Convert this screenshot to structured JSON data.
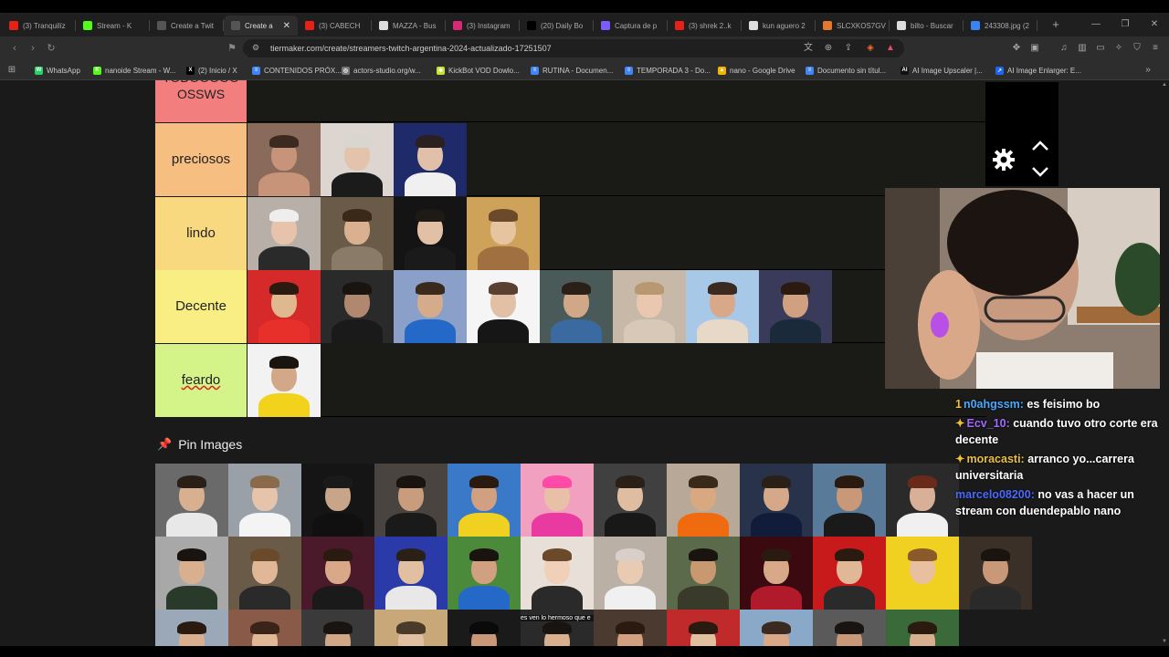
{
  "browser": {
    "tabs": [
      {
        "label": "(3) Tranquilíz",
        "icon": "youtube-icon",
        "color": "#e62117"
      },
      {
        "label": "Stream - K",
        "icon": "kick-icon",
        "color": "#53fc18"
      },
      {
        "label": "Create a Twit",
        "icon": "tiermaker-icon",
        "color": "#555"
      },
      {
        "label": "Create a",
        "icon": "tiermaker-icon",
        "color": "#555",
        "active": true
      },
      {
        "label": "(3) CABECH",
        "icon": "youtube-icon",
        "color": "#e62117"
      },
      {
        "label": "MAZZA - Bus",
        "icon": "google-icon",
        "color": "#ddd"
      },
      {
        "label": "(3) Instagram",
        "icon": "instagram-icon",
        "color": "#d62976"
      },
      {
        "label": "(20) Daily Bo",
        "icon": "x-icon",
        "color": "#000"
      },
      {
        "label": "Captura de p",
        "icon": "pen-icon",
        "color": "#7a5cff"
      },
      {
        "label": "(3) shrek 2..k",
        "icon": "youtube-icon",
        "color": "#e62117"
      },
      {
        "label": "kun aguero 2",
        "icon": "google-icon",
        "color": "#ddd"
      },
      {
        "label": "SLCXKOS7GV",
        "icon": "file-icon",
        "color": "#e8772e"
      },
      {
        "label": "bilto - Buscar",
        "icon": "google-icon",
        "color": "#ddd"
      },
      {
        "label": "243308.jpg (2",
        "icon": "image-icon",
        "color": "#3b82f6"
      }
    ],
    "new_tab": "+",
    "window_controls": {
      "minimize": "—",
      "maximize": "❐",
      "close": "✕"
    },
    "url": "tiermaker.com/create/streamers-twitch-argentina-2024-actualizado-17251507",
    "bookmarks": [
      {
        "label": "WhatsApp",
        "color": "#25d366",
        "glyph": "W"
      },
      {
        "label": "nanoide Stream - W...",
        "color": "#53fc18",
        "glyph": "K"
      },
      {
        "label": "(2) Inicio / X",
        "color": "#000",
        "glyph": "X"
      },
      {
        "label": "CONTENIDOS PRÓX...",
        "color": "#4285f4",
        "glyph": "≡"
      },
      {
        "label": "actors-studio.org/w...",
        "color": "#777",
        "glyph": "◎"
      },
      {
        "label": "KickBot VOD Dowlo...",
        "color": "#c9e22c",
        "glyph": "✱"
      },
      {
        "label": "RUTINA - Documen...",
        "color": "#4285f4",
        "glyph": "≡"
      },
      {
        "label": "TEMPORADA 3 - Do...",
        "color": "#4285f4",
        "glyph": "≡"
      },
      {
        "label": "nano - Google Drive",
        "color": "#f4b400",
        "glyph": "▲"
      },
      {
        "label": "Documento sin títul...",
        "color": "#4285f4",
        "glyph": "≡"
      },
      {
        "label": "AI Image Upscaler |...",
        "color": "#111",
        "glyph": "AI"
      },
      {
        "label": "AI Image Enlarger: E...",
        "color": "#1e66f5",
        "glyph": "↗"
      }
    ],
    "bookmarks_more": "»"
  },
  "tiers": [
    {
      "label": "TODOOOOO OSSWS",
      "color": "#f37e7e",
      "faces": []
    },
    {
      "label": "preciosos",
      "color": "#f7be82",
      "faces": [
        {
          "bg": "#8a6a5a",
          "skin": "#c79479",
          "hair": "#3a2a20",
          "shirt": "#c79479"
        },
        {
          "bg": "#ddd6d0",
          "skin": "#e4c3ad",
          "hair": "#d9d6d0",
          "shirt": "#1b1b1b"
        },
        {
          "bg": "#1e2a6a",
          "skin": "#e0c0a8",
          "hair": "#2a2020",
          "shirt": "#f0f0f0"
        }
      ]
    },
    {
      "label": "lindo",
      "color": "#f9d97f",
      "faces": [
        {
          "bg": "#b8b0a8",
          "skin": "#e6c3aa",
          "hair": "#eeeeee",
          "shirt": "#2a2a2a"
        },
        {
          "bg": "#6a5a48",
          "skin": "#d9b090",
          "hair": "#3a2818",
          "shirt": "#8a7a68"
        },
        {
          "bg": "#141414",
          "skin": "#e2c0a6",
          "hair": "#1e1a16",
          "shirt": "#1a1a1a"
        },
        {
          "bg": "#cfa25a",
          "skin": "#e6c4a0",
          "hair": "#6a4a2a",
          "shirt": "#a07040"
        }
      ]
    },
    {
      "label": "Decente",
      "color": "#f9ee84",
      "faces": [
        {
          "bg": "#d62a2a",
          "skin": "#e0b890",
          "hair": "#2a1a10",
          "shirt": "#e8302a"
        },
        {
          "bg": "#2a2a2a",
          "skin": "#b08870",
          "hair": "#1a1410",
          "shirt": "#1a1a1a"
        },
        {
          "bg": "#8aa0c8",
          "skin": "#d4ac8c",
          "hair": "#3a2a1e",
          "shirt": "#2468c8"
        },
        {
          "bg": "#f5f5f5",
          "skin": "#e2c0a6",
          "hair": "#5a4030",
          "shirt": "#161616"
        },
        {
          "bg": "#4a5a58",
          "skin": "#d0a888",
          "hair": "#2a2018",
          "shirt": "#3a6aa0"
        },
        {
          "bg": "#c8b8a8",
          "skin": "#eac8b0",
          "hair": "#b89870",
          "shirt": "#d8c8b8"
        },
        {
          "bg": "#a8c8e8",
          "skin": "#d8a888",
          "hair": "#3a2a20",
          "shirt": "#e8d8c8"
        },
        {
          "bg": "#3a3a5a",
          "skin": "#d0a080",
          "hair": "#2a1a10",
          "shirt": "#1a2a3a"
        }
      ]
    },
    {
      "label": "feardo",
      "color": "#d4f489",
      "underline": true,
      "faces": [
        {
          "bg": "#f2f2f2",
          "skin": "#d2a888",
          "hair": "#1a1410",
          "shirt": "#f2d21a"
        }
      ]
    }
  ],
  "pin": {
    "label": "Pin Images",
    "icon": "pushpin-icon"
  },
  "pin_rows": [
    [
      {
        "bg": "#6a6a6a",
        "skin": "#d8b090",
        "hair": "#2a2018",
        "shirt": "#e8e8e8"
      },
      {
        "bg": "#9aa0a8",
        "skin": "#e6c4ac",
        "hair": "#8a6a4a",
        "shirt": "#f4f4f4"
      },
      {
        "bg": "#151515",
        "skin": "#c8a488",
        "hair": "#1a1a1a",
        "shirt": "#101010"
      },
      {
        "bg": "#4a4440",
        "skin": "#c89c7c",
        "hair": "#1a1410",
        "shirt": "#1a1a1a"
      },
      {
        "bg": "#3a78c8",
        "skin": "#d0a080",
        "hair": "#2a1a10",
        "shirt": "#f0d020"
      },
      {
        "bg": "#f2a0c0",
        "skin": "#e8c0a8",
        "hair": "#ff4aa8",
        "shirt": "#e83aa0"
      },
      {
        "bg": "#404040",
        "skin": "#e0bca0",
        "hair": "#2a2018",
        "shirt": "#181818"
      },
      {
        "bg": "#b8a898",
        "skin": "#d8a880",
        "hair": "#3a2a1a",
        "shirt": "#f06a10"
      },
      {
        "bg": "#28324a",
        "skin": "#d4a888",
        "hair": "#2a2018",
        "shirt": "#101c3a"
      },
      {
        "bg": "#5a7a9a",
        "skin": "#c89878",
        "hair": "#2a1a10",
        "shirt": "#1a1a1a"
      },
      {
        "bg": "#2a2a2a",
        "skin": "#d8b098",
        "hair": "#6a2a1a",
        "shirt": "#f0f0f0"
      }
    ],
    [
      {
        "bg": "#a8a8a8",
        "skin": "#d8b090",
        "hair": "#1a1410",
        "shirt": "#2a3a2a"
      },
      {
        "bg": "#6a5a48",
        "skin": "#e0b898",
        "hair": "#6a4a2a",
        "shirt": "#2a2a2a"
      },
      {
        "bg": "#4a1a2a",
        "skin": "#d8a888",
        "hair": "#2a1a10",
        "shirt": "#1a1a1a"
      },
      {
        "bg": "#2a3aa8",
        "skin": "#e0c0a0",
        "hair": "#2a2018",
        "shirt": "#e8e8e8"
      },
      {
        "bg": "#4a8a3a",
        "skin": "#d0a080",
        "hair": "#1a1410",
        "shirt": "#2468c8"
      },
      {
        "bg": "#e8e0d8",
        "skin": "#f0d0b8",
        "hair": "#6a4a2a",
        "shirt": "#2a2a2a"
      },
      {
        "bg": "#bab0a6",
        "skin": "#e8cbb2",
        "hair": "#d8d0c8",
        "shirt": "#f0f0f0"
      },
      {
        "bg": "#5a6a4a",
        "skin": "#c89870",
        "hair": "#1a1410",
        "shirt": "#3a3a2a"
      },
      {
        "bg": "#3a0a10",
        "skin": "#d8a888",
        "hair": "#2a1a10",
        "shirt": "#b01a2a"
      },
      {
        "bg": "#c81a1a",
        "skin": "#e0b898",
        "hair": "#2a1a10",
        "shirt": "#2a2a2a"
      },
      {
        "bg": "#f0d020",
        "skin": "#e8c0a0",
        "hair": "#8a5a2a",
        "shirt": "#f0d020"
      }
    ],
    [
      {
        "bg": "#9aa8b8",
        "skin": "#d8b090",
        "hair": "#2a1a10",
        "shirt": "#2a2a2a"
      },
      {
        "bg": "#8a5a48",
        "skin": "#e0b898",
        "hair": "#3a2418",
        "shirt": "#b06a4a"
      },
      {
        "bg": "#3a3a3a",
        "skin": "#d0a888",
        "hair": "#1a1410",
        "shirt": "#2a2a2a"
      },
      {
        "bg": "#c8a878",
        "skin": "#e0c0a0",
        "hair": "#4a3a2a",
        "shirt": "#7a5a3a"
      },
      {
        "bg": "#1a1a1a",
        "skin": "#c89878",
        "hair": "#0a0a0a",
        "shirt": "#0a0a0a"
      },
      {
        "bg": "#2a2a2a",
        "skin": "#d8b090",
        "hair": "#1a1410",
        "shirt": "#2a2a2a"
      },
      {
        "bg": "#4a3a30",
        "skin": "#d0a080",
        "hair": "#2a1a10",
        "shirt": "#2a2a2a"
      },
      {
        "bg": "#c02a2a",
        "skin": "#e0c0a0",
        "hair": "#2a1a10",
        "shirt": "#e8e8e8"
      },
      {
        "bg": "#8aa8c8",
        "skin": "#d8a888",
        "hair": "#3a2a20",
        "shirt": "#3a3a3a"
      },
      {
        "bg": "#5a5a5a",
        "skin": "#c89878",
        "hair": "#1a1410",
        "shirt": "#1a1a1a"
      },
      {
        "bg": "#3a6a3a",
        "skin": "#d8b090",
        "hair": "#2a1a10",
        "shirt": "#2a2a2a"
      }
    ]
  ],
  "pin_row_extra": {
    "bg": "#3a3028",
    "skin": "#c89878",
    "hair": "#1a1410",
    "shirt": "#2a2a2a"
  },
  "pin_caption": "es ven lo hermoso que e",
  "overlay": {
    "settings_icon": "gear-icon",
    "up_icon": "chevron-up-icon",
    "down_icon": "chevron-down-icon"
  },
  "chat": [
    {
      "badge": "1",
      "user": "n0ahgssm:",
      "user_color": "#4aa8ff",
      "text": " es feisimo bo"
    },
    {
      "badge": "✦",
      "user": "Ecv_10:",
      "user_color": "#a06aff",
      "text": " cuando tuvo otro corte era decente"
    },
    {
      "badge": "✦",
      "user": "moracasti:",
      "user_color": "#e8c040",
      "text": " arranco yo...carrera universitaria"
    },
    {
      "badge": "",
      "user": "marcelo08200:",
      "user_color": "#4a6aff",
      "text": " no vas a hacer un stream con duendepablo nano"
    }
  ]
}
